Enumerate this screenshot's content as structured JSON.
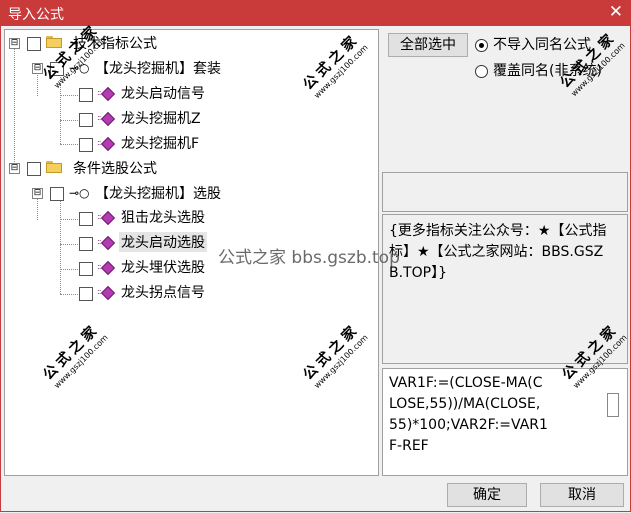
{
  "window": {
    "title": "导入公式",
    "close_glyph": "✕"
  },
  "tree": {
    "groups": [
      {
        "label": "技术指标公式",
        "expander": "⊟",
        "subgroup": {
          "label": "【龙头挖掘机】套装",
          "expander": "⊟",
          "items": [
            "龙头启动信号",
            "龙头挖掘机Z",
            "龙头挖掘机F"
          ]
        }
      },
      {
        "label": "条件选股公式",
        "expander": "⊟",
        "subgroup": {
          "label": "【龙头挖掘机】选股",
          "expander": "⊟",
          "items": [
            "狙击龙头选股",
            "龙头启动选股",
            "龙头埋伏选股",
            "龙头拐点信号"
          ]
        }
      }
    ],
    "selected_item": "龙头启动选股"
  },
  "options": {
    "select_all_label": "全部选中",
    "radio_skip_label": "不导入同名公式",
    "radio_overwrite_label": "覆盖同名(非系统)",
    "selected_radio": "skip"
  },
  "description": {
    "text": "{更多指标关注公众号：★【公式指标】★【公式之家网站：BBS.GSZB.TOP】}"
  },
  "code": {
    "text": "VAR1F:=(CLOSE-MA(CLOSE,55))/MA(CLOSE,55)*100;VAR2F:=VAR1F-REF"
  },
  "footer": {
    "ok_label": "确定",
    "cancel_label": "取消"
  },
  "watermark": {
    "stamp": "公式之家",
    "url": "www.gszj100.com",
    "center_text": "公式之家 bbs.gszb.top"
  }
}
